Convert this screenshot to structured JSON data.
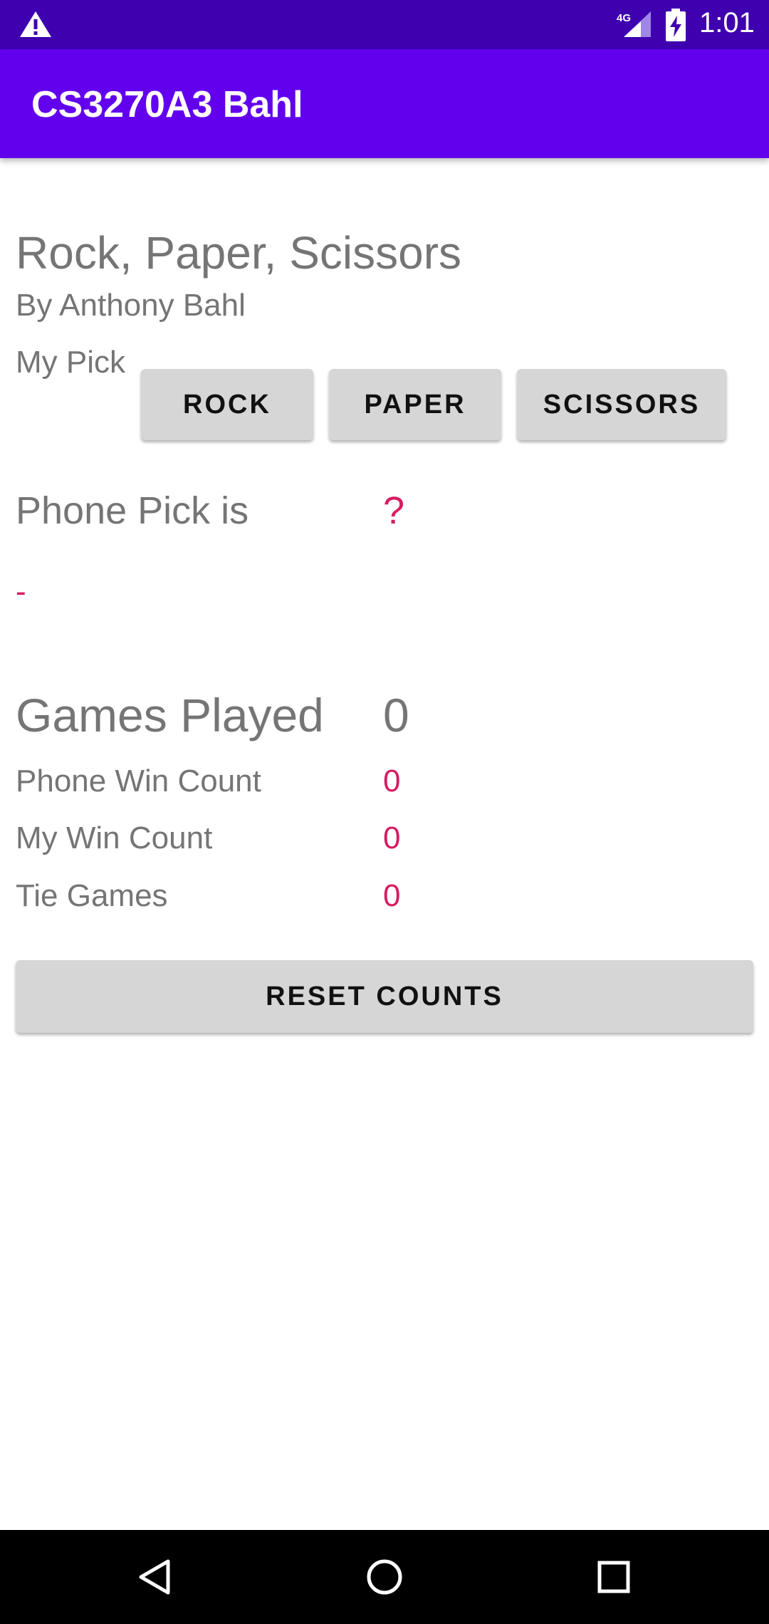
{
  "status_bar": {
    "time": "1:01",
    "network": "4G",
    "icons": [
      "warning-icon",
      "signal-icon",
      "battery-charging-icon"
    ],
    "color": "#3f00b0"
  },
  "app_bar": {
    "title": "CS3270A3 Bahl",
    "color": "#6200ee"
  },
  "header": {
    "title": "Rock, Paper, Scissors",
    "author": "By Anthony Bahl"
  },
  "my_pick": {
    "label": "My Pick",
    "buttons": {
      "rock": "ROCK",
      "paper": "PAPER",
      "scissors": "SCISSORS"
    }
  },
  "phone_pick": {
    "label": "Phone Pick is",
    "value": "?"
  },
  "result": "-",
  "stats": {
    "games_played_label": "Games Played",
    "games_played_value": "0",
    "phone_win_label": "Phone Win Count",
    "phone_win_value": "0",
    "my_win_label": "My Win Count",
    "my_win_value": "0",
    "tie_label": "Tie Games",
    "tie_value": "0"
  },
  "reset_button": "RESET COUNTS",
  "colors": {
    "accent": "#d81b60",
    "text_gray": "#757575",
    "button_bg": "#d6d6d6"
  },
  "nav_bar": {
    "icons": [
      "back-icon",
      "home-icon",
      "recents-icon"
    ]
  }
}
